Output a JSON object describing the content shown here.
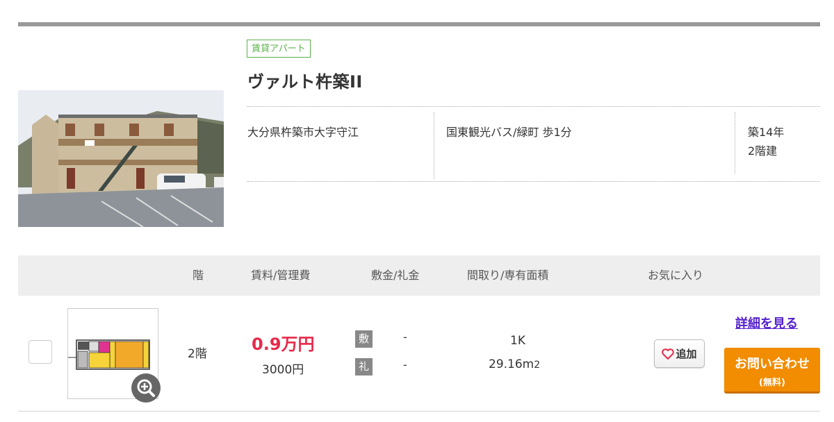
{
  "listing": {
    "category_badge": "賃貸アパート",
    "name": "ヴァルト杵築II",
    "address": "大分県杵築市大字守江",
    "access": "国東観光バス/緑町 歩1分",
    "age": "築14年",
    "structure": "2階建"
  },
  "table": {
    "headers": {
      "floor": "階",
      "rent": "賃料/管理費",
      "deposit": "敷金/礼金",
      "layout": "間取り/専有面積",
      "favorite": "お気に入り"
    }
  },
  "room": {
    "floor": "2階",
    "rent": "0.9万円",
    "management_fee": "3000円",
    "deposit_tag": "敷",
    "deposit_value": "-",
    "key_money_tag": "礼",
    "key_money_value": "-",
    "layout": "1K",
    "area": "29.16m",
    "area_unit_sup": "2",
    "favorite_button": "追加",
    "detail_link": "詳細を見る",
    "contact_button": "お問い合わせ",
    "contact_sub": "(無料)"
  },
  "colors": {
    "price": "#e8294a",
    "badge": "#5bb04b",
    "contact_button": "#f28c00",
    "link": "#5522cc"
  },
  "icons": [
    "zoom-in-icon",
    "heart-icon",
    "checkbox"
  ]
}
